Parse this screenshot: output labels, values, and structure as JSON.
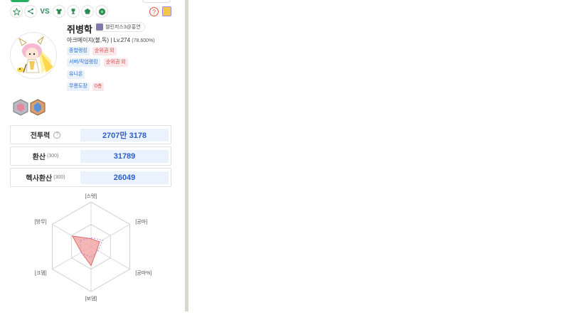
{
  "toolbar": {
    "vs_label": "VS",
    "icons": [
      "star-icon",
      "share-icon",
      "vs-icon",
      "shirt-icon",
      "trophy-icon",
      "pentagon-icon",
      "circle-badge-icon"
    ]
  },
  "header": {
    "help_label": "?"
  },
  "profile": {
    "name": "쥐병학",
    "guild": "챌린저스3@홍연",
    "job": "아크메이지(불,독)",
    "separator": "|",
    "level": "Lv.274",
    "level_percent": "(78.600%)",
    "tags": {
      "overall_rank_label": "종합랭킹",
      "overall_rank_value": "순위권 외",
      "server_rank_label": "서버/직업랭킹",
      "server_rank_value": "순위권 외",
      "union_label": "유니온",
      "dojo_label": "무릉도장",
      "dojo_value": "0층"
    }
  },
  "stats": [
    {
      "label": "전투력",
      "sub": "",
      "value": "2707만 3178",
      "has_help": true
    },
    {
      "label": "환산",
      "sub": "(300)",
      "value": "31789",
      "has_help": false
    },
    {
      "label": "헥사환산",
      "sub": "(300)",
      "value": "26049",
      "has_help": false
    }
  ],
  "colors": {
    "accent_green": "#2e8b57",
    "value_blue": "#2c5ec7",
    "value_bg": "#eaf2fd",
    "tag_blue": "#2f6fd1",
    "tag_red": "#d84b4b",
    "radar_fill": "#f3a4a4",
    "radar_stroke": "#e06a6a",
    "radar_dashed": "#b084d9"
  },
  "chart_data": {
    "type": "radar",
    "axes": [
      "[스탯]",
      "[공마]",
      "[공마%]",
      "[보뎀]",
      "[크뎀]",
      "[방무]"
    ],
    "max": 100,
    "series": [
      {
        "values": [
          18,
          22,
          15,
          42,
          25,
          48
        ]
      },
      {
        "values": [
          20,
          30,
          18,
          24,
          26,
          28
        ]
      }
    ]
  }
}
